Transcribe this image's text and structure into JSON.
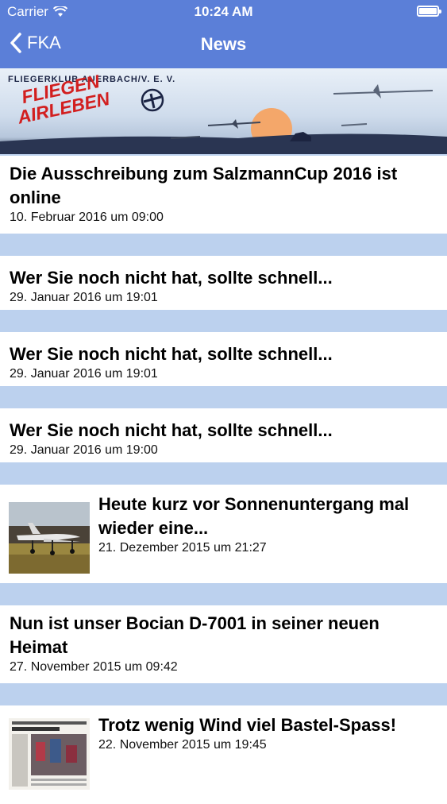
{
  "status": {
    "carrier": "Carrier",
    "time": "10:24 AM"
  },
  "nav": {
    "back_label": "FKA",
    "title": "News"
  },
  "banner": {
    "club": "FLIEGERKLUB AUERBACH/V. E. V.",
    "logo_line1": "FLIEGEN",
    "logo_line2": "AIRLEBEN"
  },
  "news": [
    {
      "title": "Die Ausschreibung zum SalzmannCup 2016 ist online",
      "date": "10. Februar 2016 um 09:00"
    },
    {
      "title": "Wer Sie noch nicht hat, sollte schnell...",
      "date": "29. Januar 2016 um 19:01"
    },
    {
      "title": "Wer Sie noch nicht hat, sollte schnell...",
      "date": "29. Januar 2016 um 19:01"
    },
    {
      "title": "Wer Sie noch nicht hat, sollte schnell...",
      "date": "29. Januar 2016 um 19:00"
    },
    {
      "title": "Heute kurz vor Sonnenuntergang mal wieder eine...",
      "date": "21. Dezember 2015 um 21:27",
      "thumb": "airplane-photo"
    },
    {
      "title": "Nun ist unser Bocian D-7001 in seiner neuen Heimat",
      "date": "27. November 2015 um 09:42"
    },
    {
      "title": "Trotz wenig Wind viel Bastel-Spass!",
      "date": "22. November 2015 um 19:45",
      "thumb": "newspaper-clipping"
    }
  ],
  "colors": {
    "bar": "#5b7fd8",
    "separator": "#bcd1ee",
    "logo_red": "#d21f1f"
  }
}
